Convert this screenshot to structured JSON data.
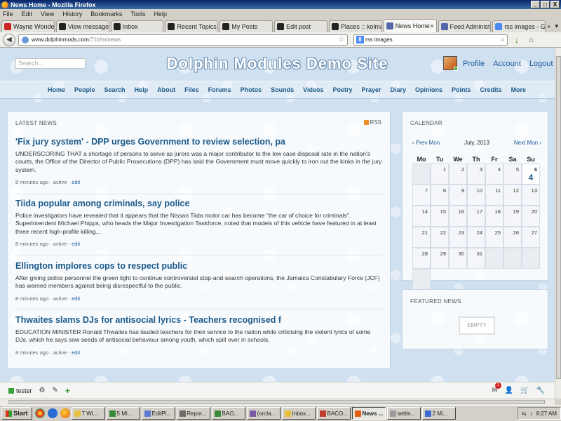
{
  "browser": {
    "window_title": "News Home - Mozilla Firefox",
    "window_buttons": [
      "_",
      "□",
      "X"
    ],
    "menu": [
      "File",
      "Edit",
      "View",
      "History",
      "Bookmarks",
      "Tools",
      "Help"
    ],
    "tabs": [
      {
        "label": "Wayne Wonder...",
        "color": "#cc2222",
        "active": false
      },
      {
        "label": "View message",
        "color": "#222222",
        "active": false
      },
      {
        "label": "Inbox",
        "color": "#222222",
        "active": false
      },
      {
        "label": "Recent Topics :...",
        "color": "#222222",
        "active": false
      },
      {
        "label": "My Posts",
        "color": "#222222",
        "active": false
      },
      {
        "label": "Edit post",
        "color": "#222222",
        "active": false
      },
      {
        "label": "Places :: kolma...",
        "color": "#222222",
        "active": false
      },
      {
        "label": "News Home",
        "color": "#5566aa",
        "active": true
      },
      {
        "label": "Feed Administr...",
        "color": "#5566aa",
        "active": false
      },
      {
        "label": "rss images - Go...",
        "color": "#4a8af4",
        "active": false
      }
    ],
    "url_host": "www.dolphinmods.com",
    "url_path": "/71b/m/news",
    "search_value": "rss images",
    "search_engine_letter": "8"
  },
  "site": {
    "search_placeholder": "Search...",
    "title": "Dolphin Modules Demo Site",
    "top_links": [
      "Profile",
      "Account",
      "Logout"
    ],
    "nav": [
      "Home",
      "People",
      "Search",
      "Help",
      "About",
      "Files",
      "Forums",
      "Photos",
      "Sounds",
      "Videos",
      "Poetry",
      "Prayer",
      "Diary",
      "Opinions",
      "Points",
      "Credits",
      "More"
    ]
  },
  "news": {
    "title": "LATEST NEWS",
    "rss_label": "RSS",
    "articles": [
      {
        "headline": "'Fix jury system' - DPP urges Government to review selection, pa",
        "body": "UNDERSCORING THAT a shortage of persons to serve as jurors was a major contributor to the low case disposal rate in the nation's courts, the Office of the Director of Public Prosecutions (DPP) has said the Government must move quickly to iron out the kinks in the jury system.",
        "time": "8 minutes ago",
        "status": "active",
        "edit": "edit"
      },
      {
        "headline": "Tiida popular among criminals, say police",
        "body": "Police investigators have revealed that it appears that the Nissan Tiida motor car has become \"the car of choice for criminals\". Superintendent Michael Phipps, who heads the Major Investigation Taskforce, noted that models of this vehicle have featured in at least three recent high-profile killing...",
        "time": "8 minutes ago",
        "status": "active",
        "edit": "edit"
      },
      {
        "headline": "Ellington implores cops to respect public",
        "body": "After giving police personnel the green light to continue controversial stop-and-search operations, the Jamaica Constabulary Force (JCF) has warned members against being disrespectful to the public.",
        "time": "8 minutes ago",
        "status": "active",
        "edit": "edit"
      },
      {
        "headline": "Thwaites slams DJs for antisocial lyrics - Teachers recognised f",
        "body": "EDUCATION MINISTER Ronald Thwaites has lauded teachers for their service to the nation while criticising the violent lyrics of some DJs, which he says sow seeds of antisocial behaviour among youth, which spill over in schools.",
        "time": "8 minutes ago",
        "status": "active",
        "edit": "edit"
      }
    ]
  },
  "calendar": {
    "title": "CALENDAR",
    "prev": "‹ Prev Mon",
    "month": "July, 2013",
    "next": "Next Mon ›",
    "weekdays": [
      "Mo",
      "Tu",
      "We",
      "Th",
      "Fr",
      "Sa",
      "Su"
    ],
    "cells": [
      "",
      "1",
      "2",
      "3",
      "4",
      "5",
      "6",
      "7",
      "8",
      "9",
      "10",
      "11",
      "12",
      "13",
      "14",
      "15",
      "16",
      "17",
      "18",
      "19",
      "20",
      "21",
      "22",
      "23",
      "24",
      "25",
      "26",
      "27",
      "28",
      "29",
      "30",
      "31",
      "",
      "",
      "",
      ""
    ],
    "today": "6",
    "today_count": "4"
  },
  "featured": {
    "title": "FEATURED NEWS",
    "empty_label": "EMPTY"
  },
  "toolbar": {
    "user": "tester",
    "mail_count": "1"
  },
  "taskbar": {
    "start": "Start",
    "items": [
      {
        "label": "7 Wi...",
        "active": false
      },
      {
        "label": "5 Mi...",
        "active": false
      },
      {
        "label": "EditPl...",
        "active": false
      },
      {
        "label": "Repor...",
        "active": false
      },
      {
        "label": "BAO...",
        "active": false
      },
      {
        "label": "(orcla...",
        "active": false
      },
      {
        "label": "Inbox...",
        "active": false
      },
      {
        "label": "BACO...",
        "active": false
      },
      {
        "label": "News ...",
        "active": true
      },
      {
        "label": "settin...",
        "active": false
      },
      {
        "label": "2 Mi...",
        "active": false
      }
    ],
    "clock": "8:27 AM"
  }
}
